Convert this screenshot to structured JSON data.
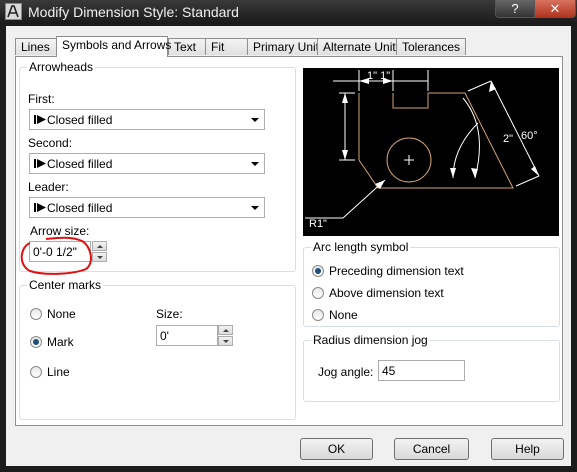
{
  "window": {
    "title": "Modify Dimension Style: Standard",
    "help_label": "?",
    "close_label": "✕"
  },
  "tabs": [
    "Lines",
    "Symbols and Arrows",
    "Text",
    "Fit",
    "Primary Units",
    "Alternate Units",
    "Tolerances"
  ],
  "arrowheads": {
    "group_label": "Arrowheads",
    "first_label": "First:",
    "first_value": "Closed filled",
    "second_label": "Second:",
    "second_value": "Closed filled",
    "leader_label": "Leader:",
    "leader_value": "Closed filled",
    "arrow_size_label": "Arrow size:",
    "arrow_size_value": "0'-0 1/2\""
  },
  "center_marks": {
    "group_label": "Center marks",
    "options": [
      "None",
      "Mark",
      "Line"
    ],
    "selected": "Mark",
    "size_label": "Size:",
    "size_value": "0'"
  },
  "preview": {
    "top_label": "1\" 1\"",
    "right_label": "2\"",
    "angle_label": "60°",
    "radius_label": "R1\""
  },
  "arc_length": {
    "group_label": "Arc length symbol",
    "options": [
      "Preceding dimension text",
      "Above dimension text",
      "None"
    ],
    "selected": "Preceding dimension text"
  },
  "radius_jog": {
    "group_label": "Radius dimension jog",
    "jog_label": "Jog angle:",
    "jog_value": "45"
  },
  "buttons": {
    "ok": "OK",
    "cancel": "Cancel",
    "help": "Help"
  },
  "colors": {
    "annotation": "#e01010",
    "preview_geometry": "#d4a373",
    "preview_dims": "#ffffff"
  }
}
